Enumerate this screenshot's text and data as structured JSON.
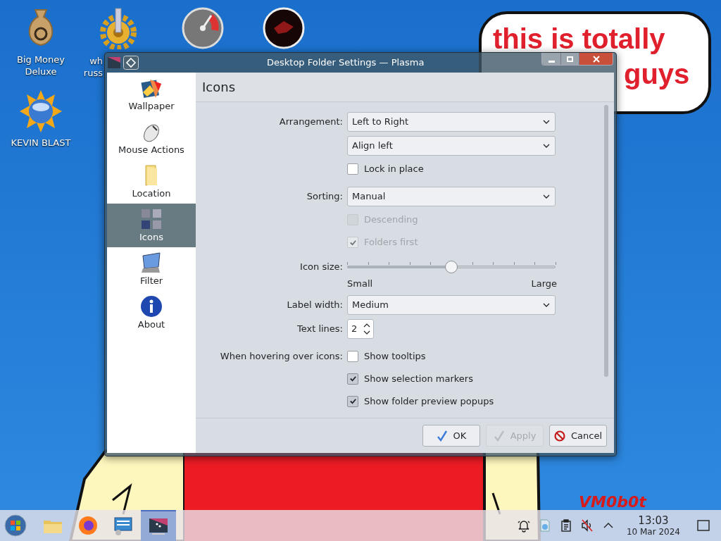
{
  "desktop_icons": [
    {
      "kind": "moneybag",
      "lines": [
        "Big Money",
        "Deluxe"
      ]
    },
    {
      "kind": "gear",
      "lines": [
        "wh",
        "russ"
      ]
    },
    {
      "kind": "gauge"
    },
    {
      "kind": "darkorb"
    },
    {
      "kind": "sunglobe",
      "lines": [
        "KEVIN BLAST"
      ]
    }
  ],
  "speech_bubble": {
    "lines": [
      "this is totally",
      "guys"
    ]
  },
  "desktop_signature": "VM0b0t",
  "window": {
    "title": "Desktop Folder Settings — Plasma",
    "sidebar": [
      {
        "kind": "wallpaper",
        "label": "Wallpaper",
        "selected": false
      },
      {
        "kind": "mouse",
        "label": "Mouse Actions",
        "selected": false
      },
      {
        "kind": "folder",
        "label": "Location",
        "selected": false
      },
      {
        "kind": "icons",
        "label": "Icons",
        "selected": true
      },
      {
        "kind": "filter",
        "label": "Filter",
        "selected": false
      },
      {
        "kind": "about",
        "label": "About",
        "selected": false
      }
    ],
    "page_title": "Icons",
    "sections": [
      {
        "rows": [
          {
            "kind": "combo",
            "label": "Arrangement:",
            "value": "Left to Right"
          },
          {
            "kind": "combo",
            "value": "Align left"
          },
          {
            "kind": "checkbox",
            "text": "Lock in place",
            "checked": false,
            "disabled": false
          }
        ]
      },
      {
        "rows": [
          {
            "kind": "combo",
            "label": "Sorting:",
            "value": "Manual"
          },
          {
            "kind": "checkbox",
            "text": "Descending",
            "checked": false,
            "disabled": true
          },
          {
            "kind": "checkbox",
            "text": "Folders first",
            "checked": true,
            "disabled": true
          }
        ]
      },
      {
        "rows": [
          {
            "kind": "slider",
            "label": "Icon size:",
            "level": 0.5,
            "min_label": "Small",
            "max_label": "Large"
          },
          {
            "kind": "combo",
            "label": "Label width:",
            "value": "Medium"
          },
          {
            "kind": "spin",
            "label": "Text lines:",
            "value": "2"
          }
        ]
      },
      {
        "rows": [
          {
            "kind": "checkbox",
            "label": "When hovering over icons:",
            "text": "Show tooltips",
            "checked": false,
            "disabled": false
          },
          {
            "kind": "checkbox",
            "text": "Show selection markers",
            "checked": true,
            "disabled": false
          },
          {
            "kind": "checkbox",
            "text": "Show folder preview popups",
            "checked": true,
            "disabled": false
          }
        ]
      }
    ],
    "buttons": [
      {
        "kind": "ok",
        "label": "OK",
        "disabled": false
      },
      {
        "kind": "apply",
        "label": "Apply",
        "disabled": true
      },
      {
        "kind": "cancel",
        "label": "Cancel",
        "disabled": false
      }
    ]
  },
  "taskbar": {
    "apps": [
      {
        "kind": "folder",
        "active": false
      },
      {
        "kind": "firefox",
        "active": false
      },
      {
        "kind": "network",
        "active": false
      },
      {
        "kind": "settings",
        "active": true
      }
    ],
    "tray": [
      {
        "kind": "bell"
      },
      {
        "kind": "updates"
      },
      {
        "kind": "clipboard"
      },
      {
        "kind": "muted"
      },
      {
        "kind": "expand"
      }
    ],
    "clock": {
      "time": "13:03",
      "date": "10 Mar 2024"
    }
  }
}
